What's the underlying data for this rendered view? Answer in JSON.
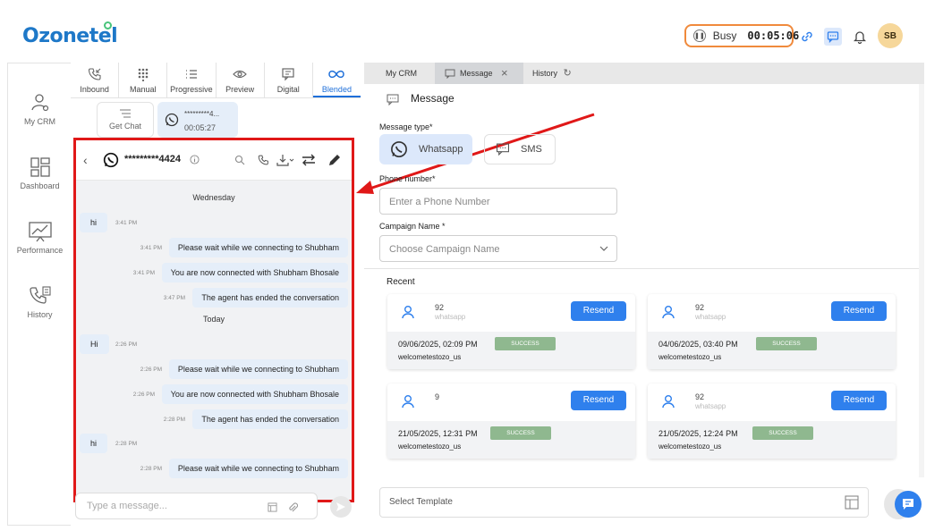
{
  "header": {
    "logo": "Ozonetel",
    "status": "Busy",
    "timer": "00:05:06",
    "avatar_initials": "SB"
  },
  "left_nav": [
    {
      "label": "My CRM",
      "icon": "user-gear-icon"
    },
    {
      "label": "Dashboard",
      "icon": "dashboard-grid-icon"
    },
    {
      "label": "Performance",
      "icon": "chart-line-icon"
    },
    {
      "label": "History",
      "icon": "call-history-icon"
    }
  ],
  "dial_tabs": [
    {
      "label": "Inbound",
      "icon": "incoming-call-icon"
    },
    {
      "label": "Manual",
      "icon": "keypad-icon"
    },
    {
      "label": "Progressive",
      "icon": "list-icon"
    },
    {
      "label": "Preview",
      "icon": "eye-icon"
    },
    {
      "label": "Digital",
      "icon": "message-icon"
    },
    {
      "label": "Blended",
      "icon": "infinity-icon",
      "active": true
    }
  ],
  "chat_list": {
    "get_chat": "Get Chat",
    "active_chat": {
      "number": "*********4...",
      "time": "00:05:27"
    }
  },
  "conversation": {
    "phone": "*********4424",
    "days": [
      "Wednesday",
      "Today"
    ],
    "messages": [
      {
        "dir": "in",
        "text": "hi",
        "time": "3:41 PM"
      },
      {
        "dir": "out",
        "text": "Please wait while we connecting to Shubham",
        "time": "3:41 PM"
      },
      {
        "dir": "out",
        "text": "You are now connected with Shubham Bhosale",
        "time": "3:41 PM"
      },
      {
        "dir": "out",
        "text": "The agent has ended the conversation",
        "time": "3:47 PM"
      },
      {
        "dir": "in",
        "text": "Hi",
        "time": "2:26 PM"
      },
      {
        "dir": "out",
        "text": "Please wait while we connecting to Shubham",
        "time": "2:26 PM"
      },
      {
        "dir": "out",
        "text": "You are now connected with Shubham Bhosale",
        "time": "2:26 PM"
      },
      {
        "dir": "out",
        "text": "The agent has ended the conversation",
        "time": "2:28 PM"
      },
      {
        "dir": "in",
        "text": "hi",
        "time": "2:28 PM"
      },
      {
        "dir": "out",
        "text": "Please wait while we connecting to Shubham",
        "time": "2:28 PM"
      }
    ],
    "compose_placeholder": "Type a message..."
  },
  "right_tabs": [
    {
      "label": "My CRM"
    },
    {
      "label": "Message",
      "active": true
    },
    {
      "label": "History"
    }
  ],
  "message_panel": {
    "title": "Message",
    "type_label": "Message type*",
    "types": [
      "Whatsapp",
      "SMS"
    ],
    "phone_label": "Phone number*",
    "phone_placeholder": "Enter a Phone Number",
    "campaign_label": "Campaign Name *",
    "campaign_placeholder": "Choose Campaign Name",
    "recent_title": "Recent",
    "recent": [
      {
        "number": "92",
        "channel": "whatsapp",
        "date": "09/06/2025, 02:09 PM",
        "status": "SUCCESS",
        "campaign": "welcometestozo_us",
        "resend": "Resend"
      },
      {
        "number": "92",
        "channel": "whatsapp",
        "date": "04/06/2025, 03:40 PM",
        "status": "SUCCESS",
        "campaign": "welcometestozo_us",
        "resend": "Resend"
      },
      {
        "number": "9",
        "channel": "",
        "date": "21/05/2025, 12:31 PM",
        "status": "SUCCESS",
        "campaign": "welcometestozo_us",
        "resend": "Resend"
      },
      {
        "number": "92",
        "channel": "whatsapp",
        "date": "21/05/2025, 12:24 PM",
        "status": "SUCCESS",
        "campaign": "welcometestozo_us",
        "resend": "Resend"
      }
    ],
    "template_placeholder": "Select Template"
  }
}
